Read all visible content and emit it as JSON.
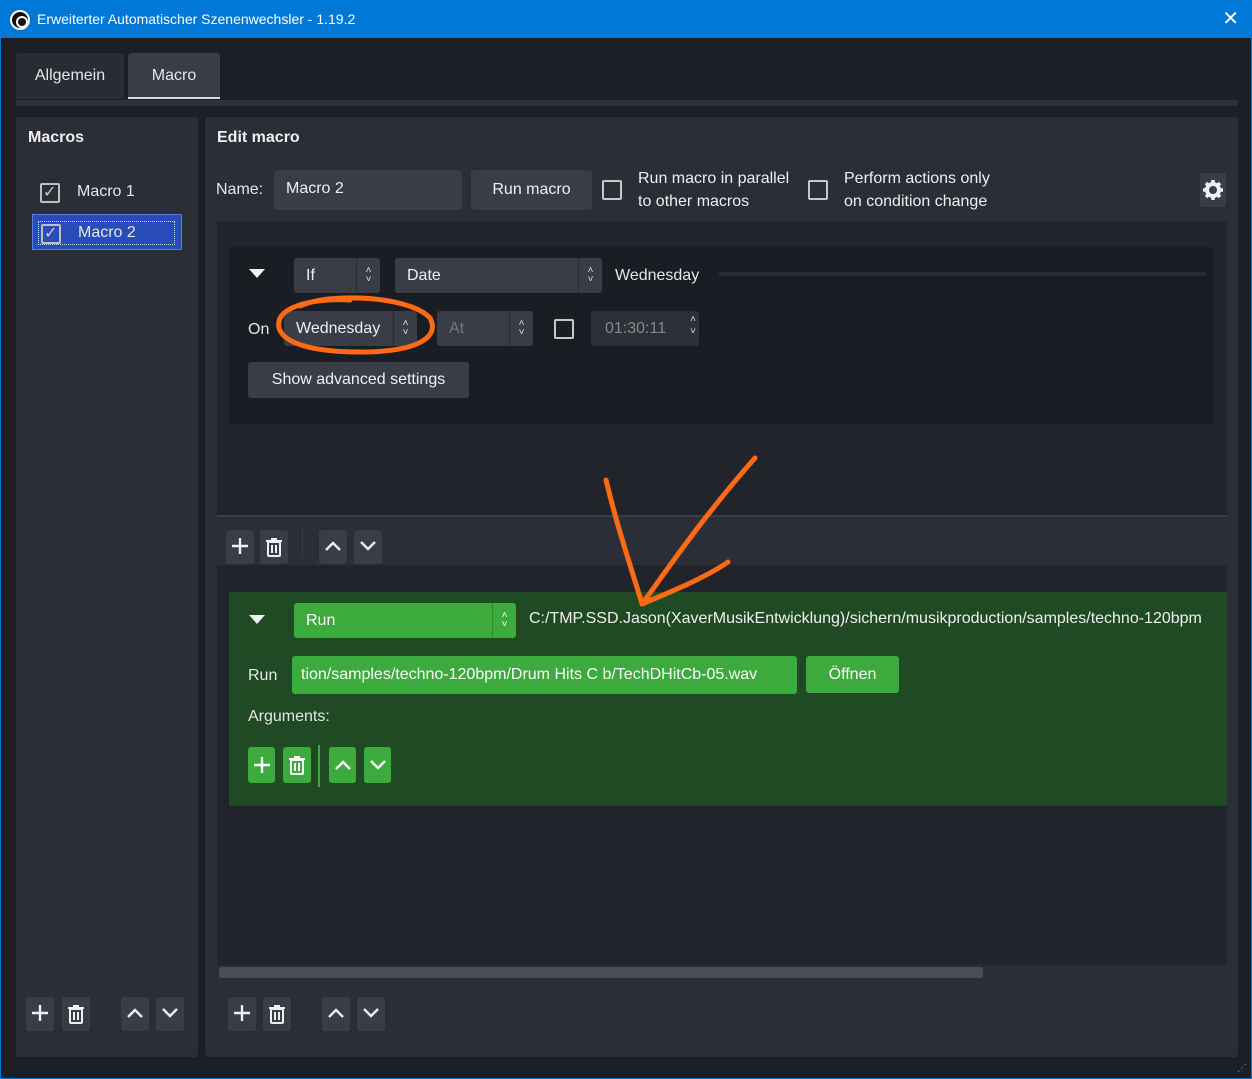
{
  "window": {
    "title": "Erweiterter Automatischer Szenenwechsler - 1.19.2",
    "close": "✕"
  },
  "tabs": [
    {
      "label": "Allgemein"
    },
    {
      "label": "Macro"
    }
  ],
  "macros": {
    "title": "Macros",
    "items": [
      {
        "label": "Macro 1",
        "checked": true
      },
      {
        "label": "Macro 2",
        "checked": true,
        "selected": true
      }
    ]
  },
  "edit": {
    "title": "Edit macro",
    "name_label": "Name:",
    "name_value": "Macro 2",
    "run_button": "Run macro",
    "parallel_label_1": "Run macro in parallel",
    "parallel_label_2": "to other macros",
    "actions_only_label_1": "Perform actions only",
    "actions_only_label_2": "on condition change"
  },
  "condition": {
    "logic": "If",
    "type": "Date",
    "summary": "Wednesday",
    "on_label": "On",
    "day": "Wednesday",
    "at": "At",
    "time": "01:30:11",
    "advanced_button": "Show advanced settings"
  },
  "action": {
    "type": "Run",
    "path_summary": "C:/TMP.SSD.Jason(XaverMusikEntwicklung)/sichern/musikproduction/samples/techno-120bpm",
    "run_label": "Run",
    "path_value": "tion/samples/techno-120bpm/Drum Hits C b/TechDHitCb-05.wav",
    "open_button": "Öffnen",
    "arguments_label": "Arguments:"
  },
  "colors": {
    "accent": "#0078d7",
    "green": "#3daa3d",
    "action_bg": "#1f4a23",
    "annotation": "#ff6a13"
  }
}
